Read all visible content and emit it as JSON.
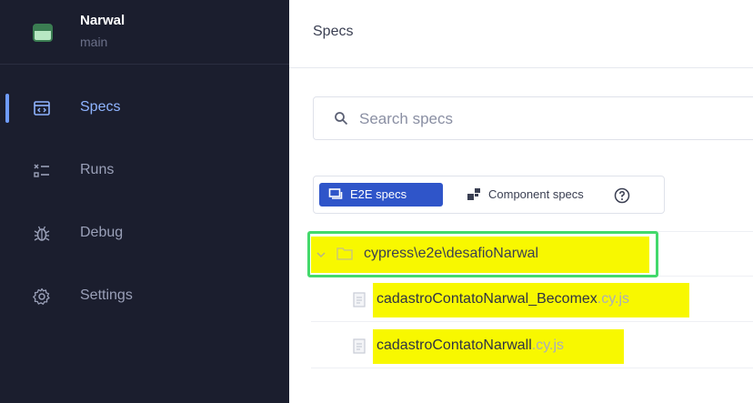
{
  "project": {
    "name": "Narwal",
    "branch": "main"
  },
  "nav": {
    "items": [
      {
        "label": "Specs",
        "icon": "specs-icon",
        "active": true
      },
      {
        "label": "Runs",
        "icon": "runs-icon",
        "active": false
      },
      {
        "label": "Debug",
        "icon": "bug-icon",
        "active": false
      },
      {
        "label": "Settings",
        "icon": "gear-icon",
        "active": false
      }
    ]
  },
  "header": {
    "title": "Specs"
  },
  "search": {
    "placeholder": "Search specs",
    "value": ""
  },
  "spec_toggle": {
    "e2e_label": "E2E specs",
    "component_label": "Component specs",
    "selected": "E2E specs"
  },
  "tree": {
    "folder": {
      "label": "cypress\\e2e\\desafioNarwal",
      "expanded": true
    },
    "files": [
      {
        "name": "cadastroContatoNarwal_Becomex",
        "ext": ".cy.js"
      },
      {
        "name": "cadastroContatoNarwall",
        "ext": ".cy.js"
      }
    ]
  },
  "colors": {
    "sidebar_bg": "#1b1e2e",
    "active_accent": "#6f9cff",
    "toggle_selected": "#2f55c9",
    "highlight": "#f8f800",
    "focus_outline": "#43d96b"
  }
}
